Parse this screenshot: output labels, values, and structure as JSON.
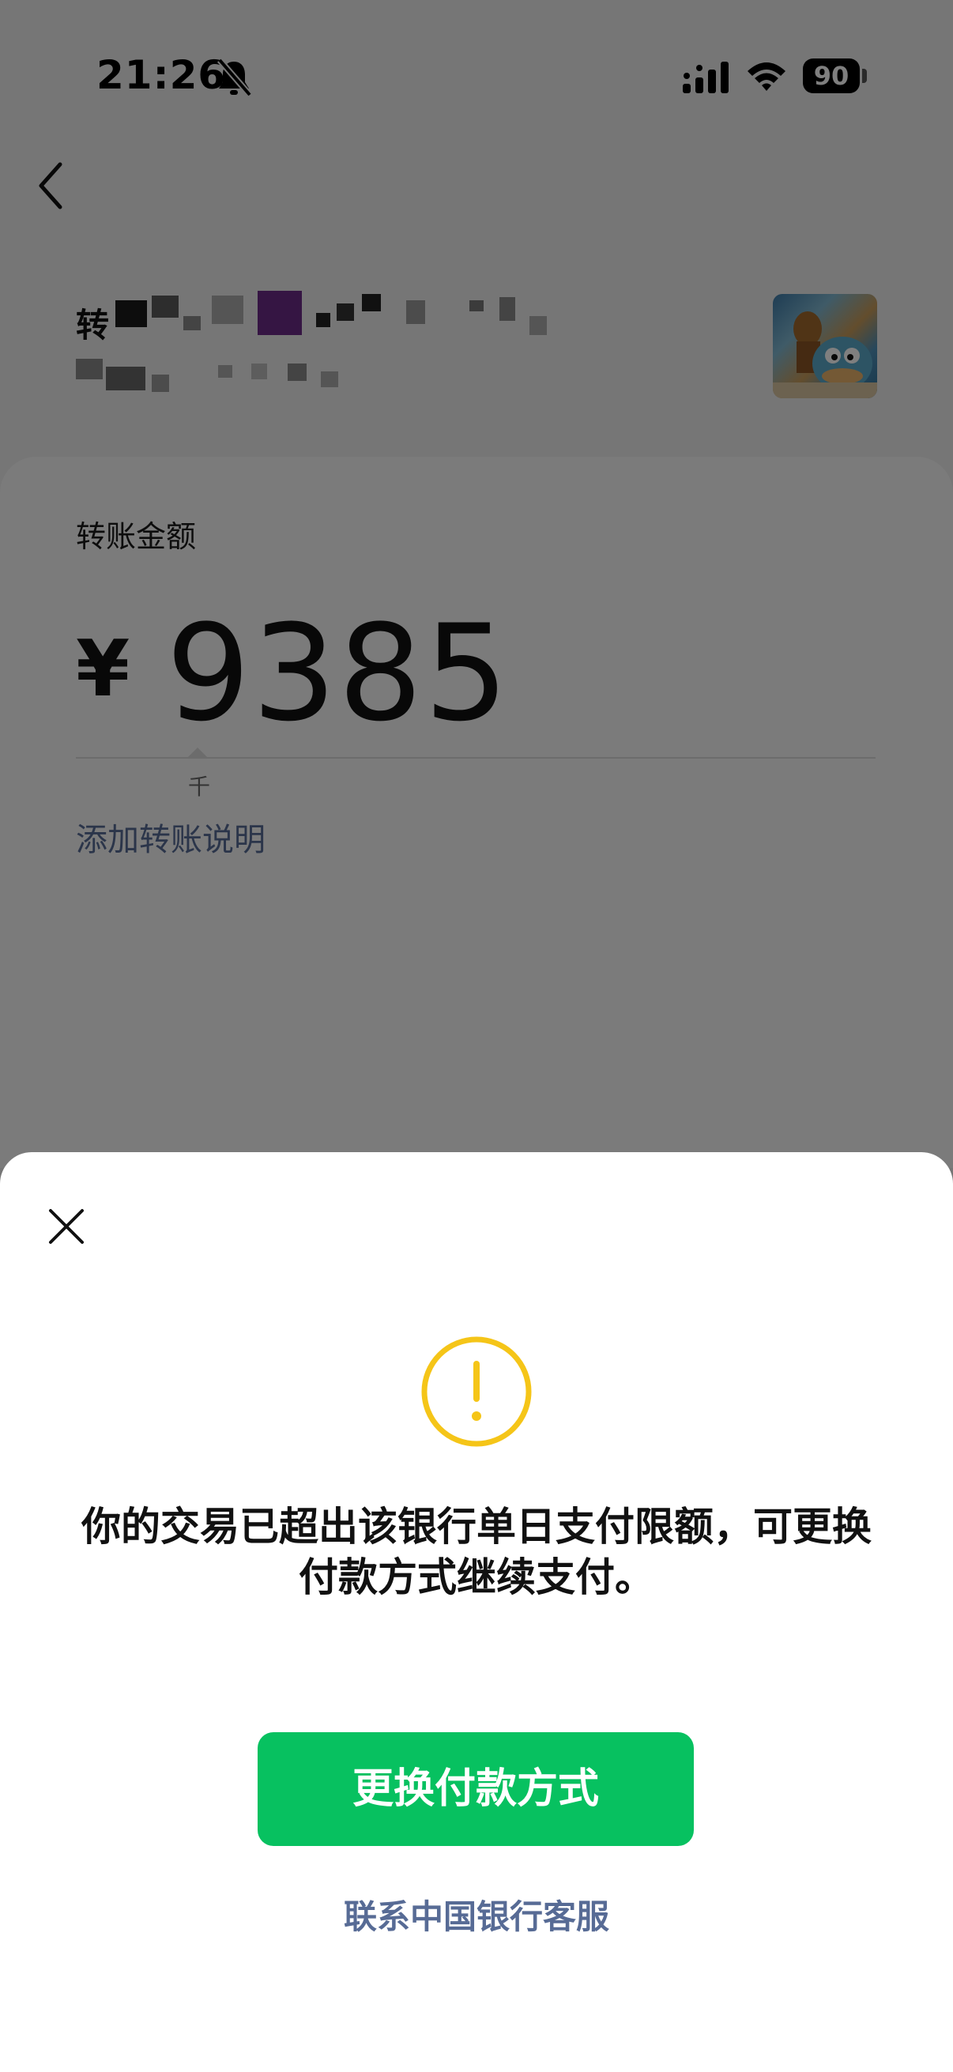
{
  "status_bar": {
    "time": "21:26",
    "battery": "90",
    "icons": [
      "bell-slash-icon",
      "signal-icon",
      "wifi-icon",
      "battery-icon"
    ]
  },
  "header": {
    "back_icon": "chevron-left-icon"
  },
  "recipient": {
    "label_prefix": "转"
  },
  "amount_section": {
    "label": "转账金额",
    "currency": "¥",
    "amount": "9385",
    "unit_hint": "千",
    "add_note": "添加转账说明"
  },
  "dialog": {
    "close_icon": "close-icon",
    "warning_icon": "exclamation-circle-icon",
    "message": "你的交易已超出该银行单日支付限额，可更换付款方式继续支付。",
    "primary_button": "更换付款方式",
    "secondary_link": "联系中国银行客服"
  },
  "colors": {
    "accent_green": "#07c160",
    "link_blue": "#576b95",
    "warning_yellow": "#f5c518"
  }
}
